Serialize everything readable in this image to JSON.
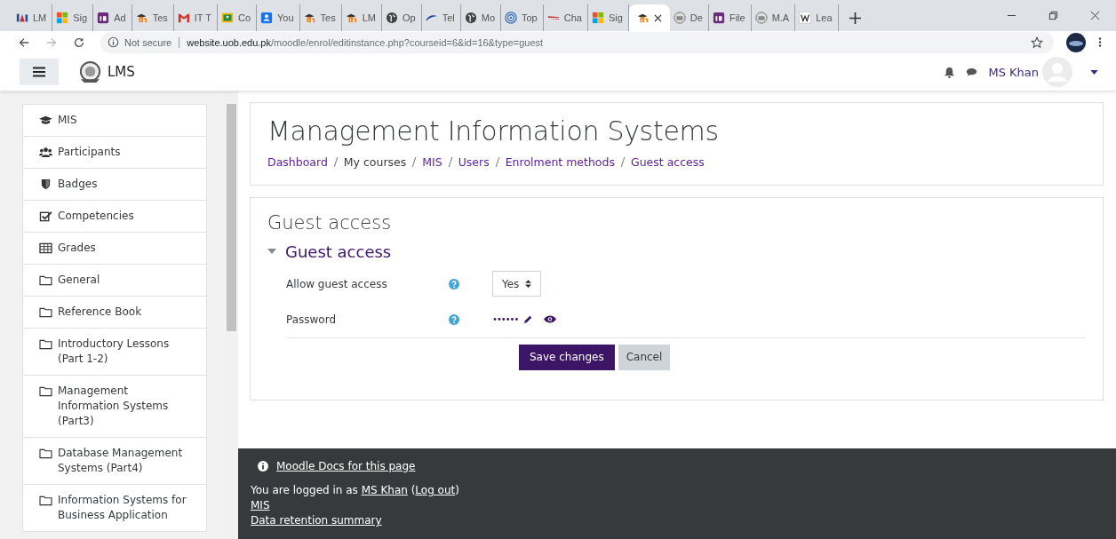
{
  "browser": {
    "tabs": [
      {
        "title": "LM",
        "kind": "lms",
        "selected": false
      },
      {
        "title": "Sig",
        "kind": "windows",
        "selected": false
      },
      {
        "title": "Ad",
        "kind": "invision",
        "selected": false
      },
      {
        "title": "Tes",
        "kind": "moodle",
        "selected": false
      },
      {
        "title": "IT T",
        "kind": "gmail",
        "selected": false
      },
      {
        "title": "Co",
        "kind": "classroom",
        "selected": false
      },
      {
        "title": "You",
        "kind": "contacts",
        "selected": false
      },
      {
        "title": "Tes",
        "kind": "moodle",
        "selected": false
      },
      {
        "title": "LM",
        "kind": "moodle",
        "selected": false
      },
      {
        "title": "Op",
        "kind": "globe",
        "selected": false
      },
      {
        "title": "Tel",
        "kind": "pta",
        "selected": false
      },
      {
        "title": "Mo",
        "kind": "globe",
        "selected": false
      },
      {
        "title": "Top",
        "kind": "target",
        "selected": false
      },
      {
        "title": "Cha",
        "kind": "stripe",
        "selected": false
      },
      {
        "title": "Sig",
        "kind": "windows",
        "selected": false
      },
      {
        "kind": "moodle",
        "selected": true
      },
      {
        "title": "De",
        "kind": "server",
        "selected": false
      },
      {
        "title": "File",
        "kind": "invision",
        "selected": false
      },
      {
        "title": "M.A",
        "kind": "server",
        "selected": false
      },
      {
        "title": "Lea",
        "kind": "wiki",
        "selected": false
      }
    ],
    "security": "Not secure",
    "url": "**website.uob.edu.pk**/moodle/enrol/editinstance.php?courseid=6&id=16&type=guest"
  },
  "navbar": {
    "site": "LMS",
    "user": "MS Khan"
  },
  "sidebar": {
    "items": [
      {
        "label": "MIS",
        "kind": "cap"
      },
      {
        "label": "Participants",
        "kind": "users"
      },
      {
        "label": "Badges",
        "kind": "shield"
      },
      {
        "label": "Competencies",
        "kind": "check"
      },
      {
        "label": "Grades",
        "kind": "table"
      },
      {
        "label": "General",
        "kind": "folder"
      },
      {
        "label": "Reference Book",
        "kind": "folder"
      },
      {
        "label": "Introductory Lessons (Part 1-2)",
        "kind": "folder"
      },
      {
        "label": "Management Information Systems (Part3)",
        "kind": "folder"
      },
      {
        "label": "Database Management Systems (Part4)",
        "kind": "folder"
      },
      {
        "label": "Information Systems for Business Application",
        "kind": "folder"
      }
    ]
  },
  "header": {
    "title": "Management Information Systems",
    "breadcrumbs": [
      "Dashboard",
      "My courses",
      "MIS",
      "Users",
      "Enrolment methods",
      "Guest access"
    ]
  },
  "form": {
    "heading": "Guest access",
    "section": "Guest access",
    "expanded": true,
    "fields": [
      {
        "label": "Allow guest access",
        "kind": "select",
        "value": "Yes"
      },
      {
        "label": "Password",
        "kind": "password",
        "value": "••••••"
      }
    ],
    "buttons": [
      {
        "label": "Save changes",
        "kind": "primary"
      },
      {
        "label": "Cancel",
        "kind": "secondary"
      }
    ]
  },
  "footer": {
    "docs": "Moodle Docs for this page",
    "login_prefix": "You are logged in as ",
    "login_user": "MS Khan",
    "login_mid": " (",
    "logout": "Log out",
    "login_suffix": ")",
    "links": [
      "MIS",
      "Data retention summary"
    ]
  }
}
